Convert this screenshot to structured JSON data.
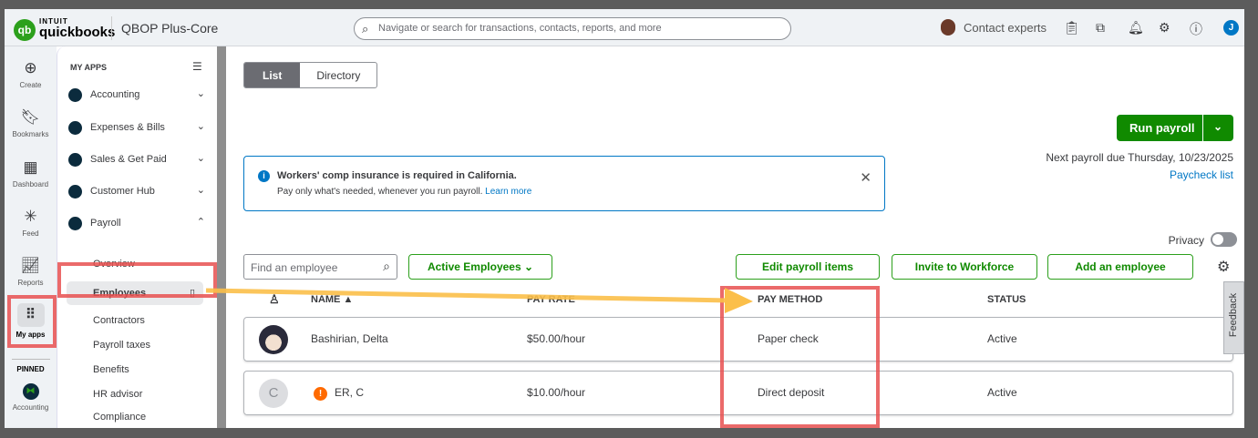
{
  "header": {
    "brand_top": "INTUIT",
    "brand": "quickbooks",
    "company": "QBOP Plus-Core",
    "search_placeholder": "Navigate or search for transactions, contacts, reports, and more",
    "contact": "Contact experts",
    "user_initial": "J"
  },
  "rail": [
    {
      "label": "Create"
    },
    {
      "label": "Bookmarks"
    },
    {
      "label": "Dashboard"
    },
    {
      "label": "Feed"
    },
    {
      "label": "Reports"
    },
    {
      "label": "My apps"
    }
  ],
  "rail_pinned": "PINNED",
  "rail_pinned_item": "Accounting",
  "apps": {
    "title": "MY APPS",
    "items": [
      "Accounting",
      "Expenses & Bills",
      "Sales & Get Paid",
      "Customer Hub",
      "Payroll"
    ],
    "payroll_sub": [
      "Overview",
      "Employees",
      "Contractors",
      "Payroll taxes",
      "Benefits",
      "HR advisor",
      "Compliance"
    ]
  },
  "main": {
    "tabs": [
      "List",
      "Directory"
    ],
    "run_payroll": "Run payroll",
    "next_due": "Next payroll due Thursday, 10/23/2025",
    "paycheck_list": "Paycheck list",
    "banner": {
      "title": "Workers' comp insurance is required in California.",
      "body": "Pay only what's needed, whenever you run payroll.",
      "link": "Learn more"
    },
    "privacy": "Privacy",
    "find_placeholder": "Find an employee",
    "filter": "Active Employees",
    "buttons": [
      "Edit payroll items",
      "Invite to Workforce",
      "Add an employee"
    ],
    "columns": [
      "NAME ▲",
      "PAY RATE",
      "PAY METHOD",
      "STATUS"
    ],
    "rows": [
      {
        "name": "Bashirian, Delta",
        "rate": "$50.00/hour",
        "method": "Paper check",
        "status": "Active"
      },
      {
        "initial": "C",
        "name": "ER, C",
        "rate": "$10.00/hour",
        "method": "Direct deposit",
        "status": "Active"
      }
    ],
    "feedback": "Feedback"
  },
  "colors": {
    "accent": "#108a00",
    "link": "#0077c5",
    "annotation_red": "#e85050",
    "annotation_arrow": "#fbbf4a"
  }
}
